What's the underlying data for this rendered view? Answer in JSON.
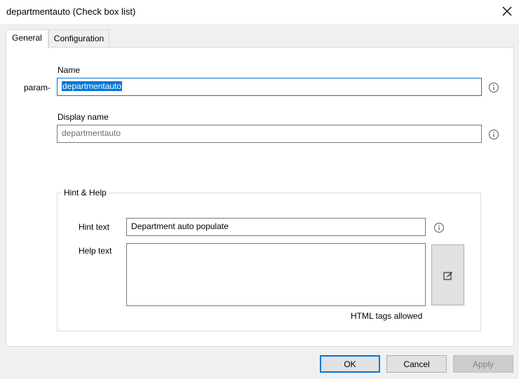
{
  "window": {
    "title": "departmentauto (Check box list)",
    "close_icon": "close-icon"
  },
  "tabs": [
    {
      "label": "General",
      "active": true
    },
    {
      "label": "Configuration",
      "active": false
    }
  ],
  "general": {
    "name_label": "Name",
    "name_prefix": "param-",
    "name_value": "departmentauto",
    "display_name_label": "Display name",
    "display_name_value": "departmentauto",
    "info_icon": "info-icon"
  },
  "hint_help": {
    "group_label": "Hint & Help",
    "hint_label": "Hint text",
    "hint_value": "Department auto populate",
    "help_label": "Help text",
    "help_value": "",
    "html_note": "HTML tags allowed",
    "edit_icon": "edit-icon"
  },
  "buttons": {
    "ok": "OK",
    "cancel": "Cancel",
    "apply": "Apply"
  },
  "colors": {
    "accent": "#0078d7",
    "selection": "#0078d7",
    "dialog_bg": "#f0f0f0",
    "panel_bg": "#ffffff"
  }
}
